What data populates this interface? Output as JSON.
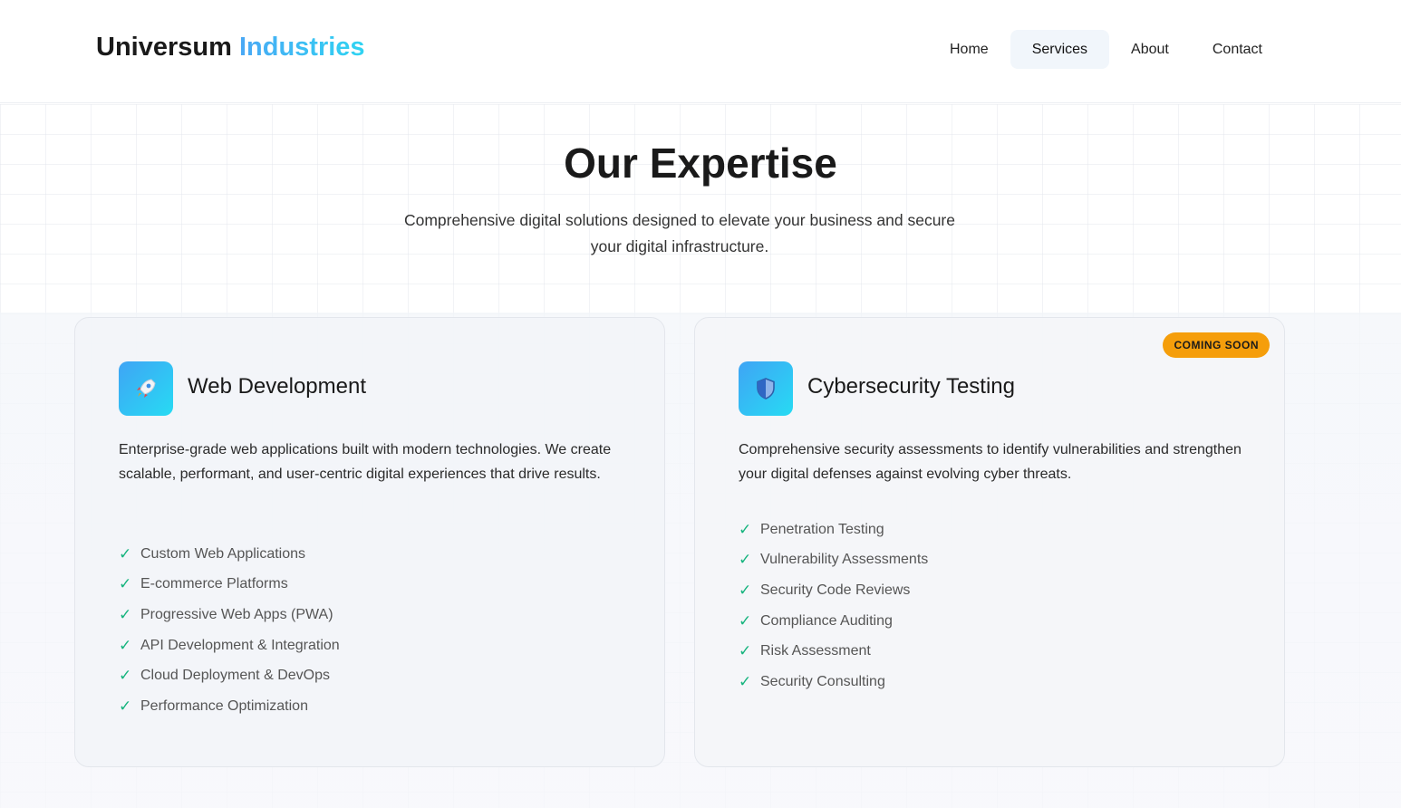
{
  "header": {
    "brand_part1": "Universum",
    "brand_part2": "Industries",
    "nav": [
      {
        "label": "Home"
      },
      {
        "label": "Services",
        "active": true
      },
      {
        "label": "About"
      },
      {
        "label": "Contact"
      }
    ]
  },
  "section": {
    "title": "Our Expertise",
    "subtitle": "Comprehensive digital solutions designed to elevate your business and secure your digital infrastructure."
  },
  "cards": [
    {
      "icon": "rocket-icon",
      "title": "Web Development",
      "description": "Enterprise-grade web applications built with modern technologies. We create scalable, performant, and user-centric digital experiences that drive results.",
      "features": [
        "Custom Web Applications",
        "E-commerce Platforms",
        "Progressive Web Apps (PWA)",
        "API Development & Integration",
        "Cloud Deployment & DevOps",
        "Performance Optimization"
      ]
    },
    {
      "icon": "shield-icon",
      "title": "Cybersecurity Testing",
      "badge": "COMING SOON",
      "description": "Comprehensive security assessments to identify vulnerabilities and strengthen your digital defenses against evolving cyber threats.",
      "features": [
        "Penetration Testing",
        "Vulnerability Assessments",
        "Security Code Reviews",
        "Compliance Auditing",
        "Risk Assessment",
        "Security Consulting"
      ]
    }
  ],
  "check_mark": "✓",
  "colors": {
    "accent_gradient_start": "#4aa8f5",
    "accent_gradient_end": "#2fd4f2",
    "check_green": "#16b47e",
    "badge_orange": "#f59e0b"
  }
}
